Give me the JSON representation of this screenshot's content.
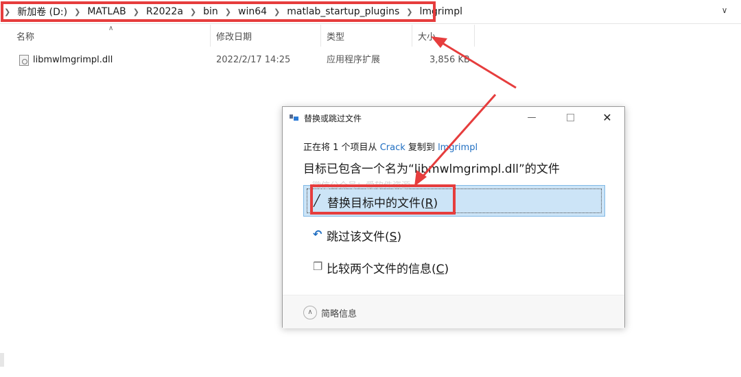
{
  "breadcrumb": [
    "新加卷 (D:)",
    "MATLAB",
    "R2022a",
    "bin",
    "win64",
    "matlab_startup_plugins",
    "lmgrimpl"
  ],
  "columns": {
    "name": "名称",
    "modified": "修改日期",
    "type": "类型",
    "size": "大小"
  },
  "file": {
    "name": "libmwlmgrimpl.dll",
    "modified": "2022/2/17 14:25",
    "type": "应用程序扩展",
    "size": "3,856 KB"
  },
  "dialog": {
    "title": "替换或跳过文件",
    "copy_prefix": "正在将 1 个项目从",
    "copy_source": "Crack",
    "copy_mid": "复制到",
    "copy_dest": "lmgrimpl",
    "headline": "目标已包含一个名为“libmwlmgrimpl.dll”的文件",
    "options": {
      "replace": {
        "text": "替换目标中的文件(",
        "key": "R",
        "close": ")"
      },
      "skip": {
        "text": "跳过该文件(",
        "key": "S",
        "close": ")"
      },
      "compare": {
        "text": "比较两个文件的信息(",
        "key": "C",
        "close": ")"
      }
    },
    "footer": "简略信息"
  },
  "watermark": "微信公众号：爱软件资源",
  "colors": {
    "highlight": "#e63d3d",
    "selection": "#cce4f7",
    "link": "#1f6ec2"
  }
}
